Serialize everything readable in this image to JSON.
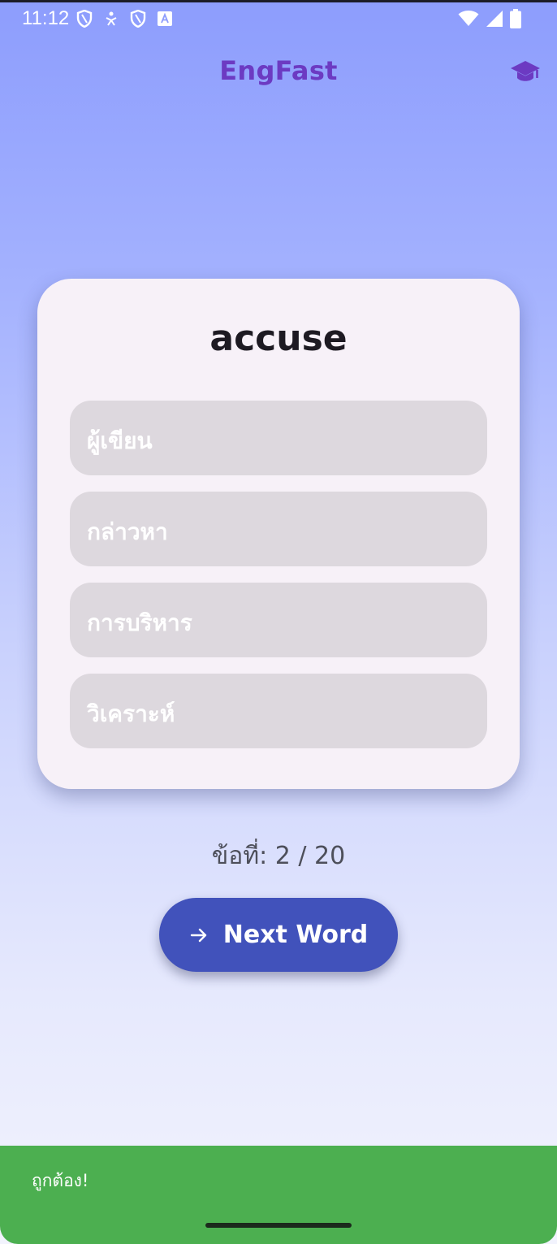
{
  "status_bar": {
    "time": "11:12",
    "left_icons": [
      "shield-outline-icon",
      "accessibility-icon",
      "shield-outline-icon",
      "font-a-icon"
    ],
    "right_icons": [
      "wifi-icon",
      "cellular-signal-icon",
      "battery-icon"
    ]
  },
  "header": {
    "title": "EngFast",
    "title_color": "#6c3ac2",
    "action_icon": "graduation-cap-icon"
  },
  "quiz": {
    "word": "accuse",
    "options": [
      "ผู้เขียน",
      "กล่าวหา",
      "การบริหาร",
      "วิเคราะห์"
    ],
    "progress_text": "ข้อที่: 2 / 20",
    "current_question": 2,
    "total_questions": 20
  },
  "next_button": {
    "label": "Next Word",
    "icon": "arrow-right-icon",
    "color": "#4152bb"
  },
  "snackbar": {
    "message": "ถูกต้อง!",
    "color": "#4caf50"
  }
}
